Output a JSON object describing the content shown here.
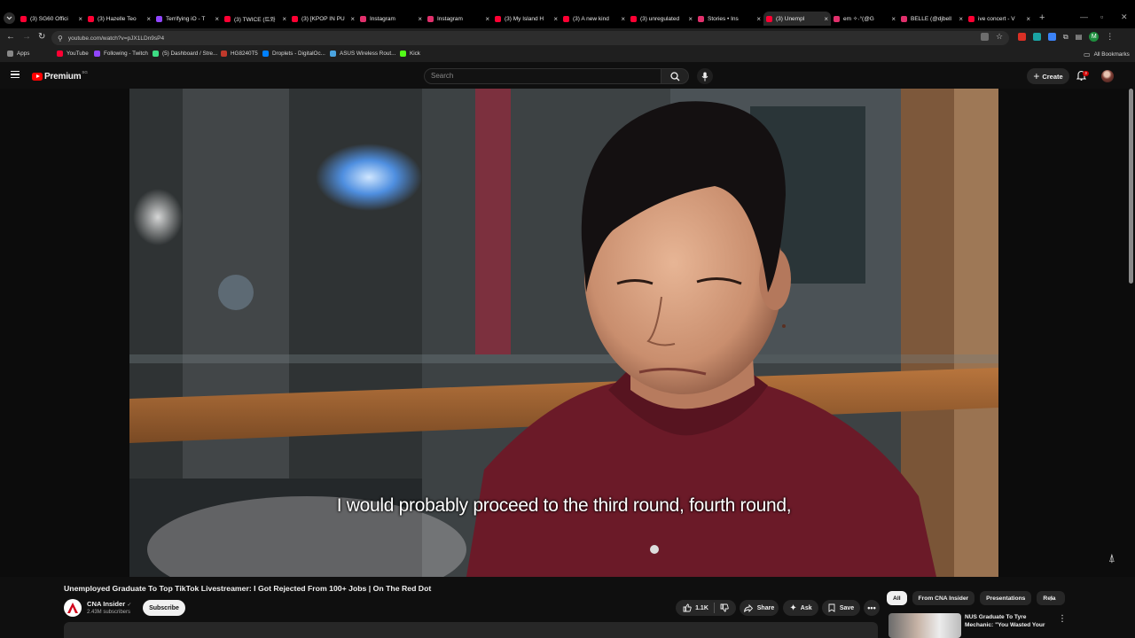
{
  "browser": {
    "tabs": [
      {
        "label": "(3) SG60 Offici",
        "color": "#ff0033"
      },
      {
        "label": "(3) Hazelle Teo",
        "color": "#ff0033"
      },
      {
        "label": "Terrifying iO - T",
        "color": "#9146ff"
      },
      {
        "label": "(3) TWICE (트와",
        "color": "#ff0033"
      },
      {
        "label": "(3) [KPOP IN PU",
        "color": "#ff0033"
      },
      {
        "label": "Instagram",
        "color": "#e1306c"
      },
      {
        "label": "Instagram",
        "color": "#e1306c"
      },
      {
        "label": "(3) My Island H",
        "color": "#ff0033"
      },
      {
        "label": "(3) A new kind",
        "color": "#ff0033"
      },
      {
        "label": "(3) unregulated",
        "color": "#ff0033"
      },
      {
        "label": "Stories • Ins",
        "color": "#e1306c"
      },
      {
        "label": "(3) Unempl",
        "color": "#ff0033",
        "active": true
      },
      {
        "label": "em ✧˖°(@G",
        "color": "#e1306c"
      },
      {
        "label": "BELLE (@djbell",
        "color": "#e1306c"
      },
      {
        "label": "ive concert - V",
        "color": "#ff0033"
      }
    ],
    "new_tab": "+",
    "url": "youtube.com/watch?v=pJX1LDn9sP4",
    "bookmarks": [
      {
        "label": "Apps",
        "color": "#888888"
      },
      {
        "label": "YouTube",
        "color": "#ff0033"
      },
      {
        "label": "Following - Twitch",
        "color": "#9146ff"
      },
      {
        "label": "(5) Dashboard / Stre...",
        "color": "#3ddc84"
      },
      {
        "label": "HG8240T5",
        "color": "#c0392b"
      },
      {
        "label": "Droplets - DigitalOc...",
        "color": "#0080ff"
      },
      {
        "label": "ASUS Wireless Rout...",
        "color": "#4aa3df"
      },
      {
        "label": "Kick",
        "color": "#53fc18"
      }
    ],
    "all_bookmarks": "All Bookmarks",
    "profile_initial": "M"
  },
  "youtube": {
    "brand": "Premium",
    "region": "SG",
    "search_placeholder": "Search",
    "create_label": "Create",
    "notification_count": "3"
  },
  "video": {
    "caption": "I would probably proceed to the third round, fourth round,",
    "title": "Unemployed Graduate To Top TikTok Livestreamer: I Got Rejected From 100+ Jobs | On The Red Dot",
    "channel_name": "CNA Insider",
    "channel_verified": "✓",
    "subscribers": "2.43M subscribers",
    "subscribe_label": "Subscribe",
    "likes": "1.1K",
    "share_label": "Share",
    "ask_label": "Ask",
    "save_label": "Save"
  },
  "sidebar": {
    "chips": [
      "All",
      "From CNA Insider",
      "Presentations",
      "Rela"
    ],
    "recommendation_title": "NUS Graduate To Tyre Mechanic: \"You Wasted Your"
  },
  "colors": {
    "youtube_red": "#ff0000",
    "background": "#0f0f0f",
    "pill_bg": "#272727"
  }
}
